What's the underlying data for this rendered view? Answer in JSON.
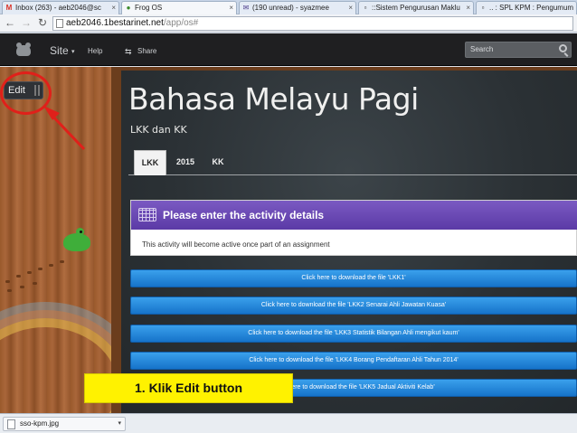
{
  "browser": {
    "tabs": [
      {
        "icon": "gmail-icon",
        "label": "Inbox (263) - aeb2046@sc",
        "active": false
      },
      {
        "icon": "frog-icon",
        "label": "Frog OS",
        "active": true
      },
      {
        "icon": "mail-icon",
        "label": "(190 unread) - syazmee",
        "active": false
      },
      {
        "icon": "page-icon",
        "label": "::Sistem Pengurusan Maklu",
        "active": false
      },
      {
        "icon": "page-icon",
        "label": ".. : SPL KPM : Pengumum",
        "active": false
      }
    ],
    "url_host": "aeb2046.1bestarinet.net",
    "url_path": "/app/os#"
  },
  "header": {
    "site_label": "Site",
    "caret": "▾",
    "help_label": "Help",
    "share_label": "Share",
    "search_placeholder": "Search"
  },
  "edit_button": {
    "label": "Edit"
  },
  "page": {
    "title": "Bahasa Melayu Pagi",
    "subtitle": "LKK dan KK",
    "tabs": [
      "LKK",
      "2015",
      "KK"
    ]
  },
  "activity": {
    "title": "Please enter the activity details",
    "message": "This activity will become active once part of an assignment"
  },
  "downloads": [
    "Click here to download the file 'LKK1'",
    "Click here to download the file 'LKK2 Senarai Ahli Jawatan Kuasa'",
    "Click here to download the file 'LKK3 Statistik Bilangan Ahli mengikut kaum'",
    "Click here to download the file 'LKK4 Borang Pendaftaran Ahli Tahun 2014'",
    "Click here to download the file 'LKK5 Jadual Aktiviti Kelab'"
  ],
  "caption": "1. Klik Edit button",
  "download_bar": {
    "file": "sso-kpm.jpg",
    "caret": "▾"
  },
  "colors": {
    "annotation": "#e0201a",
    "caption_bg": "#fff200",
    "activity_head": "#6a4ab5",
    "download_button": "#2a8ae0"
  }
}
